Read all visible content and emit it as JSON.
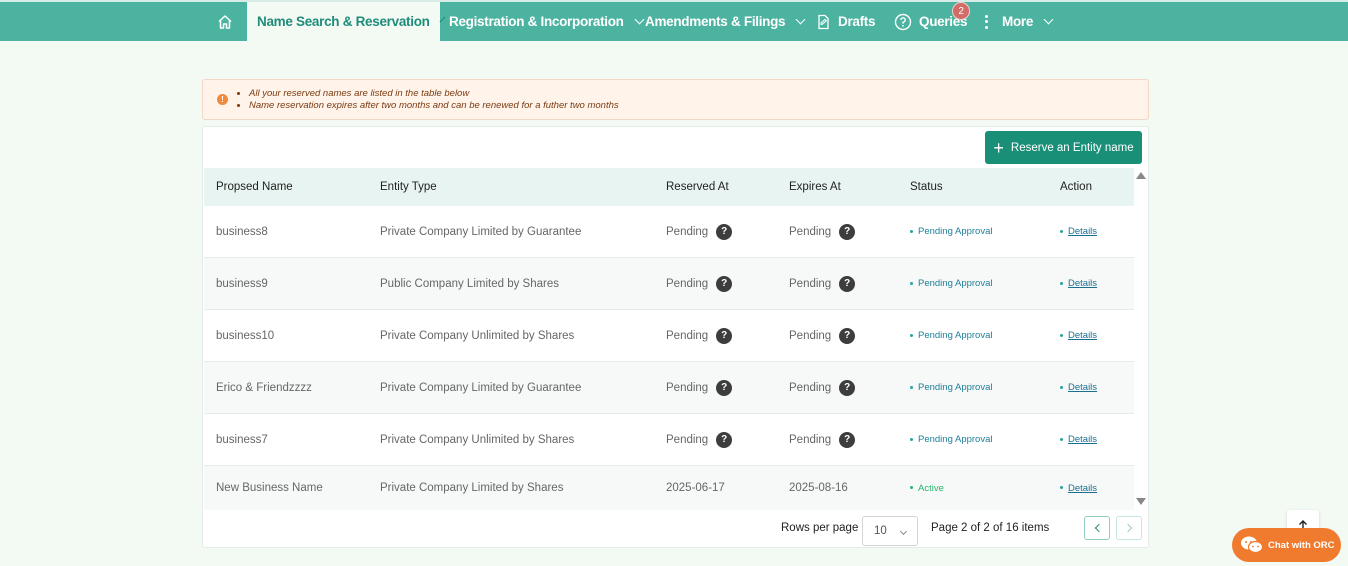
{
  "nav": {
    "home_icon": "home-icon",
    "items": [
      {
        "label": "Name Search & Reservation"
      },
      {
        "label": "Registration & Incorporation"
      },
      {
        "label": "Amendments & Filings"
      },
      {
        "label": "Drafts"
      },
      {
        "label": "Queries",
        "badge": "2"
      },
      {
        "label": "More"
      }
    ]
  },
  "alert": {
    "lines": [
      "All your reserved names are listed in the table below",
      "Name reservation expires after two months and can be renewed for a futher two months"
    ]
  },
  "toolbar": {
    "reserve_label": "Reserve an Entity name"
  },
  "table": {
    "headers": [
      "Propsed Name",
      "Entity Type",
      "Reserved At",
      "Expires At",
      "Status",
      "Action"
    ],
    "rows": [
      {
        "name": "business8",
        "type": "Private Company Limited by Guarantee",
        "reserved": "Pending",
        "expires": "Pending",
        "status": "Pending Approval",
        "action": "Details"
      },
      {
        "name": "business9",
        "type": "Public Company Limited by Shares",
        "reserved": "Pending",
        "expires": "Pending",
        "status": "Pending Approval",
        "action": "Details"
      },
      {
        "name": "business10",
        "type": "Private Company Unlimited by Shares",
        "reserved": "Pending",
        "expires": "Pending",
        "status": "Pending Approval",
        "action": "Details"
      },
      {
        "name": "Erico & Friendzzzz",
        "type": "Private Company Limited by Guarantee",
        "reserved": "Pending",
        "expires": "Pending",
        "status": "Pending Approval",
        "action": "Details"
      },
      {
        "name": "business7",
        "type": "Private Company Unlimited by Shares",
        "reserved": "Pending",
        "expires": "Pending",
        "status": "Pending Approval",
        "action": "Details"
      },
      {
        "name": "New Business Name",
        "type": "Private Company Limited by Shares",
        "reserved": "2025-06-17",
        "expires": "2025-08-16",
        "status": "Active",
        "action": "Details"
      }
    ]
  },
  "pagination": {
    "rows_per_page_label": "Rows per page",
    "rows_per_page_value": "10",
    "page_info": "Page 2 of 2 of 16 items"
  },
  "floating": {
    "chat_label": "Chat with ORC"
  },
  "colors": {
    "nav_bg": "#4cb3a0",
    "primary": "#1a8f78",
    "chat": "#f07a2e"
  }
}
